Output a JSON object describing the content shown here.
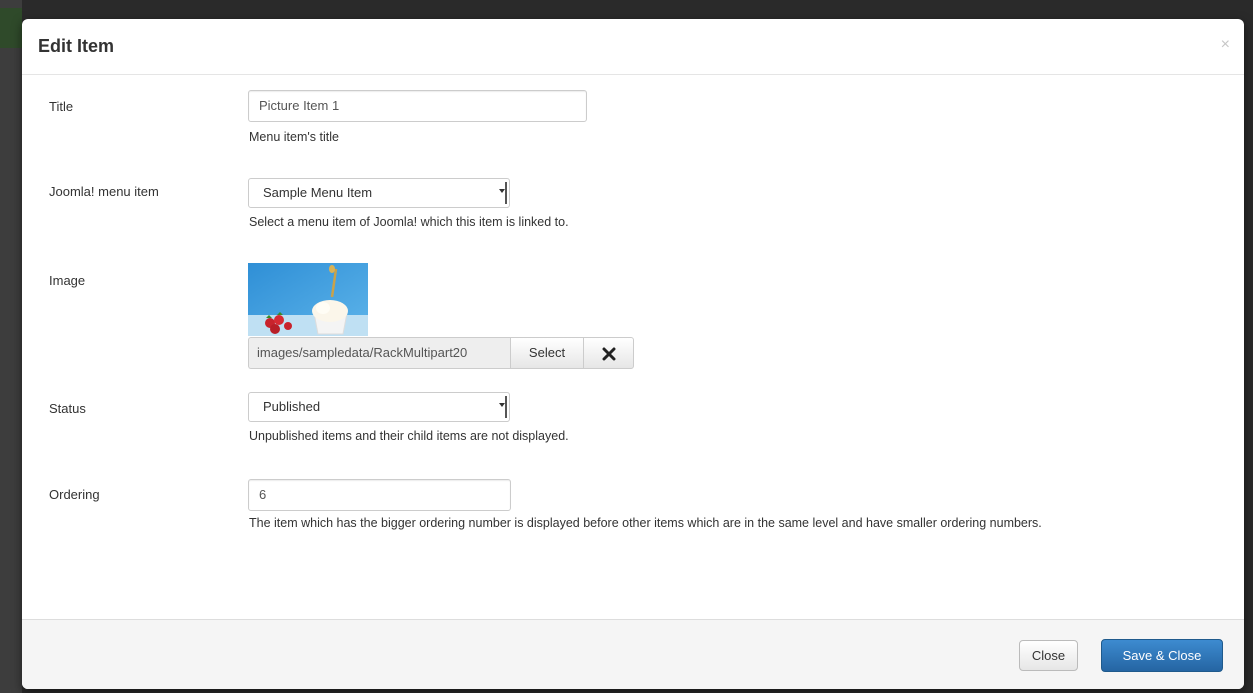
{
  "modal": {
    "title": "Edit Item",
    "close_symbol": "×"
  },
  "fields": {
    "title": {
      "label": "Title",
      "value": "Picture Item 1",
      "help": "Menu item's title"
    },
    "menu_item": {
      "label": "Joomla! menu item",
      "selected": "Sample Menu Item",
      "help": "Select a menu item of Joomla! which this item is linked to."
    },
    "image": {
      "label": "Image",
      "path": "images/sampledata/RackMultipart20",
      "select_label": "Select",
      "clear_icon": "times-icon"
    },
    "status": {
      "label": "Status",
      "selected": "Published",
      "help": "Unpublished items and their child items are not displayed."
    },
    "ordering": {
      "label": "Ordering",
      "value": "6",
      "help": "The item which has the bigger ordering number is displayed before other items which are in the same level and have smaller ordering numbers."
    }
  },
  "footer": {
    "close_label": "Close",
    "save_label": "Save & Close"
  },
  "colors": {
    "primary": "#2f74b8",
    "footer_bg": "#f5f5f5",
    "backdrop": "#2a2a2a"
  }
}
